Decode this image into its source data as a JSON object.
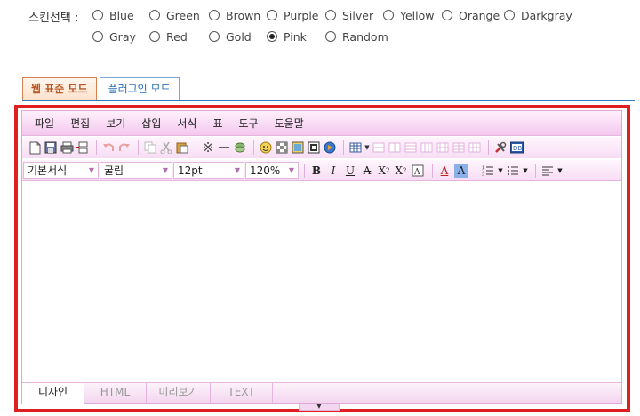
{
  "skin": {
    "label": "스킨선택 :",
    "options": [
      "Blue",
      "Green",
      "Brown",
      "Purple",
      "Silver",
      "Yellow",
      "Orange",
      "Darkgray",
      "Gray",
      "Red",
      "Gold",
      "Pink",
      "Random"
    ],
    "selected": "Pink"
  },
  "mode_tabs": [
    "웹 표준 모드",
    "플러그인 모드"
  ],
  "menu": [
    "파일",
    "편집",
    "보기",
    "삽입",
    "서식",
    "표",
    "도구",
    "도움말"
  ],
  "format": {
    "style": "기본서식",
    "font": "굴림",
    "size": "12pt",
    "line_height": "120%"
  },
  "bottom_tabs": [
    "디자인",
    "HTML",
    "미리보기",
    "TEXT"
  ],
  "colors": {
    "accent_pink": "#f3c8ee",
    "frame_red": "#e02020",
    "tab_blue": "#2e7bc0"
  }
}
